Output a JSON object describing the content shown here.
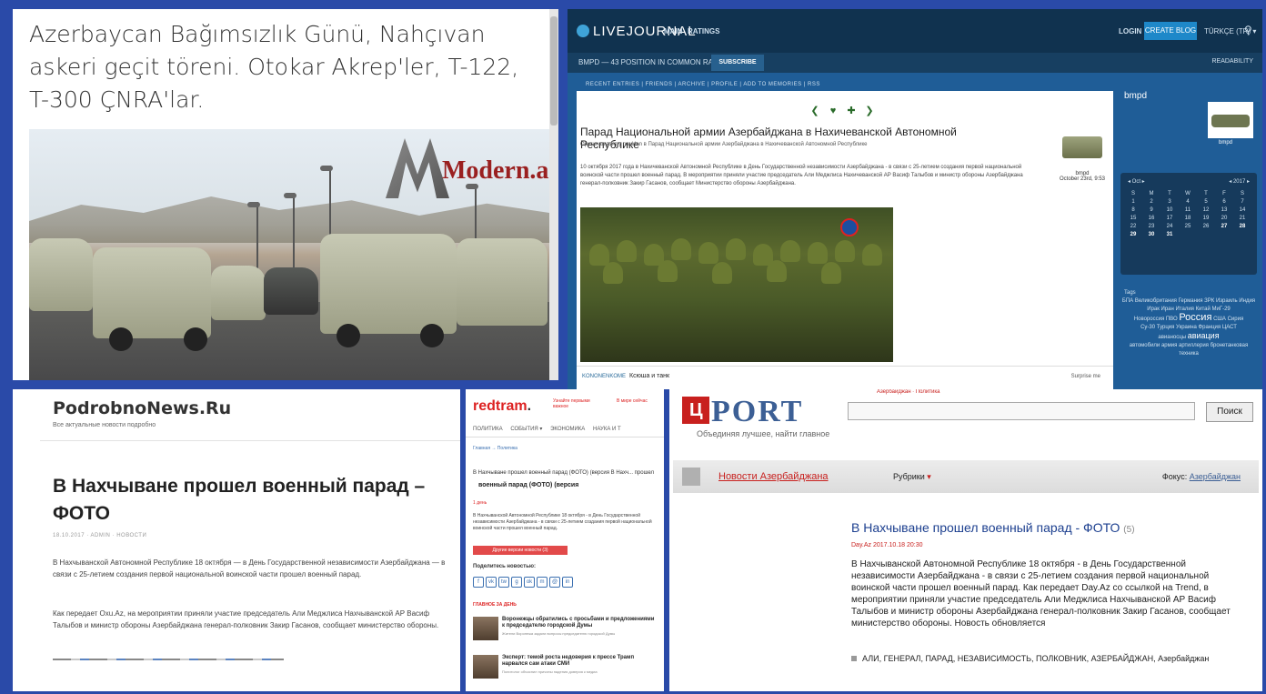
{
  "panel1": {
    "title": "Azerbaycan Bağımsızlık Günü, Nahçıvan askeri geçit töreni. Otokar Akrep'ler, T-122, T-300 ÇNRA'lar.",
    "logo_text": "Modern.az"
  },
  "livejournal": {
    "logo": "LIVEJOURNAL",
    "nav_main": "MAIN",
    "nav_ratings": "RATINGS",
    "login": "LOGIN",
    "create_blog": "CREATE BLOG",
    "lang": "TÜRKÇE (TR) ▾",
    "user_line": "BMPD — 43 POSITION IN COMMON RATING",
    "subscribe": "SUBSCRIBE",
    "readability": "READABILITY",
    "links": "RECENT ENTRIES  |  FRIENDS  |  ARCHIVE  |  PROFILE  |  ADD TO MEMORIES  |  RSS",
    "post_title": "Парад Национальной армии Азербайджана в Нахичеванской Автономной Республике",
    "post_meta": "Оригинал взят у naviden в Парад Национальной армии Азербайджана в Нахичеванской Автономной Республике",
    "post_body": "10 октября 2017 года в Нахичеванской Автономной Республике в День Государственной независимости Азербайджана - в связи с 25-летием создания первой национальной воинской части прошел военный парад. В мероприятии приняли участие председатель Али Меджлиса Нахичеванской АР Васиф Талыбов и министр обороны Азербайджана генерал-полковник Закир Гасанов, сообщает Министерство обороны Азербайджана.",
    "author": "bmpd",
    "author_date": "October 23rd, 9:53",
    "bottom_a": "KONONENKOME",
    "bottom_b": "Ксюша и танк",
    "bottom_c": "Surprise me",
    "side_name": "bmpd",
    "side_user": "bmpd",
    "cal_left": "◂ Oct ▸",
    "cal_right": "◂ 2017 ▸",
    "cal_days": [
      "S",
      "M",
      "T",
      "W",
      "T",
      "F",
      "S",
      "1",
      "2",
      "3",
      "4",
      "5",
      "6",
      "7",
      "8",
      "9",
      "10",
      "11",
      "12",
      "13",
      "14",
      "15",
      "16",
      "17",
      "18",
      "19",
      "20",
      "21",
      "22",
      "23",
      "24",
      "25",
      "26",
      "27",
      "28",
      "29",
      "30",
      "31"
    ],
    "tags_label": "Tags",
    "tags_line1": "БПА Великобритания Германия ЗРК Израиль Индия Ирак Иран Италия Китай МиГ-29",
    "tags_line2": "Новороссия ПВО",
    "tags_big": "Россия",
    "tags_line3": "США Сирия",
    "tags_line4": "Су-30 Турция Украина Франция ЦАСТ",
    "tags_line5": "авианосцы",
    "tags_med": "авиация",
    "tags_line6": "автомобили армия артиллерия бронетанковая техника"
  },
  "podrobno": {
    "logo": "PodrobnoNews.Ru",
    "tagline": "Все актуальные новости подробно",
    "headline": "В Нахчыване прошел военный парад – ФОТО",
    "meta": "18.10.2017  ·  ADMIN  ·  НОВОСТИ",
    "para1": "В Нахчыванской Автономной Республике 18 октября — в День Государственной независимости Азербайджана — в связи с 25-летием создания первой национальной воинской части прошел военный парад.",
    "para2": "Как передает Oxu.Az, на мероприятии приняли участие председатель Али Меджлиса Нахчыванской АР Васиф Талыбов и министр обороны Азербайджана генерал-полковник Закир Гасанов, сообщает министерство обороны."
  },
  "redtram": {
    "logo_red": "redtram",
    "logo_dot": ".",
    "side1": "Узнайте первыми важное",
    "side2": "В мире сейчас",
    "menu": [
      "ПОЛИТИКА",
      "СОБЫТИЯ ▾",
      "ЭКОНОМИКА",
      "НАУКА И Т"
    ],
    "crumb": "Главная  →  Политика",
    "head_line": "В Нахчыване прошел военный парад (ФОТО) (версия    В Нахч... прошел",
    "head2": "военный парад (ФОТО) (версия",
    "date": "1 день",
    "body": "В Нахчыванской Автономной Республике 18 октября - в День Государственной независимости Азербайджана - в связи с 25-летием создания первой национальной воинской части прошел военный парад.",
    "btn": "Другие версии новости (3)",
    "share": "Поделитесь новостью:",
    "share_icons": [
      "f",
      "vk",
      "tw",
      "g",
      "ok",
      "m",
      "@",
      "in"
    ],
    "red_label": "ГЛАВНОЕ ЗА ДЕНЬ",
    "item1": "Воронежцы обратились с просьбами и предложениями к председателю городской Думы",
    "item1_sm": "Жители Воронежа задали вопросы председателю городской Думы",
    "item2": "Эксперт: темой роста недоверия к прессе Трамп нарвался сам атаки СМИ",
    "item2_sm": "Политолог объяснил причины падения доверия к медиа"
  },
  "port": {
    "logo_char": "Ц",
    "logo_word": "PORT",
    "slogan": "Объединяя лучшее, найти главное",
    "search_btn": "Поиск",
    "top_red": "Азербайджан  ·  Политика",
    "section": "Новости Азербайджана",
    "rubrics": "Рубрики",
    "focus_label": "Фокус:",
    "focus_value": "Азербайджан",
    "headline": "В Нахчыване прошел военный парад - ФОТО",
    "count": "(5)",
    "date": "Day.Az 2017.10.18 20:30",
    "body": "В Нахчыванской Автономной Республике 18 октября - в День Государственной независимости Азербайджана - в связи с 25-летием создания первой национальной воинской части прошел военный парад. Как передает Day.Az со ссылкой на Trend, в мероприятии приняли участие председатель Али Меджлиса Нахчыванской АР Васиф Талыбов и министр обороны Азербайджана генерал-полковник Закир Гасанов, сообщает министерство обороны. Новость обновляется",
    "tags": "АЛИ, ГЕНЕРАЛ, ПАРАД, НЕЗАВИСИМОСТЬ, ПОЛКОВНИК, АЗЕРБАЙДЖАН, Азербайджан"
  }
}
